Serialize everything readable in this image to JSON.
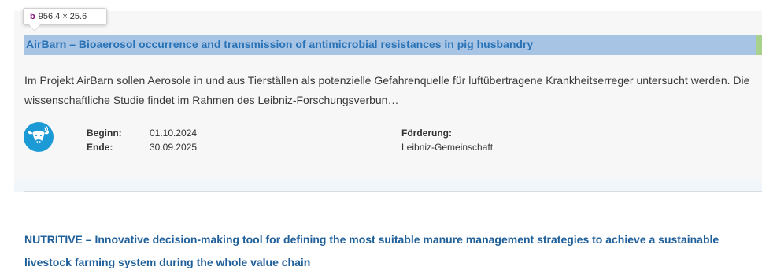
{
  "tooltip": {
    "tag": "b",
    "size": "956.4 × 25.6"
  },
  "project1": {
    "title": "AirBarn – Bioaerosol occurrence and transmission of antimicrobial resistances in pig husbandry",
    "description": "Im Projekt AirBarn sollen Aerosole in und aus Tierställen als potenzielle Gefahrenquelle für luftübertragene Krankheitserreger untersucht werden. Die wissenschaftliche Studie findet im Rahmen des Leibniz-Forschungsverbun…",
    "icon": "cow-icon",
    "start_label": "Beginn:",
    "start_value": "01.10.2024",
    "end_label": "Ende:",
    "end_value": "30.09.2025",
    "funding_label": "Förderung:",
    "funding_value": "Leibniz-Gemeinschaft"
  },
  "project2": {
    "title": "NUTRITIVE – Innovative decision-making tool for defining the most suitable manure management strategies to achieve a sustainable livestock farming system during the whole value chain"
  },
  "colors": {
    "link": "#2872b5",
    "highlight": "#a7c4e5",
    "icon_bg": "#1c9ad6"
  }
}
